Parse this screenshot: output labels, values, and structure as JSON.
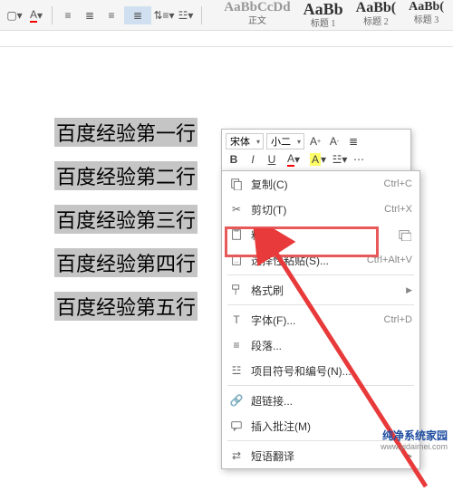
{
  "ribbon": {
    "styles": [
      {
        "sample": "AaBbCcDd",
        "label": "正文"
      },
      {
        "sample": "AaBb",
        "label": "标题 1"
      },
      {
        "sample": "AaBb(",
        "label": "标题 2"
      },
      {
        "sample": "AaBb(",
        "label": "标题 3"
      }
    ]
  },
  "document": {
    "lines": [
      "百度经验第一行",
      "百度经验第二行",
      "百度经验第三行",
      "百度经验第四行",
      "百度经验第五行"
    ]
  },
  "mini_toolbar": {
    "font_name": "宋体",
    "font_size": "小二",
    "bold": "B",
    "italic": "I",
    "underline": "U",
    "font_color_letter": "A",
    "highlight_letter": "A"
  },
  "context_menu": {
    "copy": {
      "label": "复制(C)",
      "shortcut": "Ctrl+C"
    },
    "cut": {
      "label": "剪切(T)",
      "shortcut": "Ctrl+X"
    },
    "paste": {
      "label": "粘贴"
    },
    "paste_special": {
      "label": "选择性粘贴(S)...",
      "shortcut": "Ctrl+Alt+V"
    },
    "format_painter": {
      "label": "格式刷"
    },
    "font": {
      "label": "字体(F)...",
      "shortcut": "Ctrl+D"
    },
    "paragraph": {
      "label": "段落..."
    },
    "bullets": {
      "label": "项目符号和编号(N)..."
    },
    "hyperlink": {
      "label": "超链接..."
    },
    "insert_comment": {
      "label": "插入批注(M)"
    },
    "translate": {
      "label": "短语翻译"
    }
  },
  "watermark": {
    "line1": "纯净系统家园",
    "line2": "www.yidaimei.com"
  },
  "chart_data": null
}
